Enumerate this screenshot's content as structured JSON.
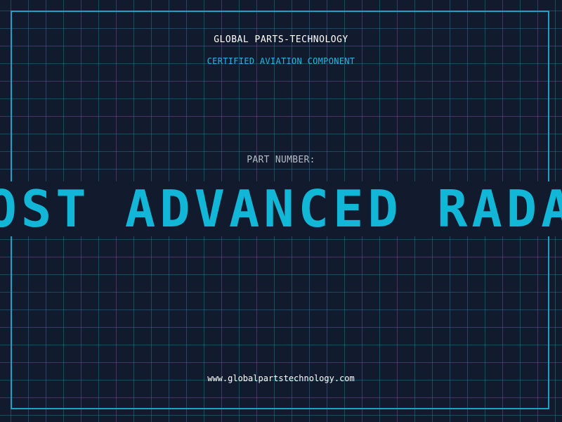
{
  "header": {
    "company": "GLOBAL PARTS-TECHNOLOGY",
    "subtitle": "CERTIFIED AVIATION COMPONENT"
  },
  "part": {
    "label": "PART NUMBER:",
    "value": "MOST ADVANCED RADAR"
  },
  "footer": {
    "url": "www.globalpartstechnology.com"
  },
  "colors": {
    "background": "#121a2e",
    "accent": "#12b7d8",
    "frame": "#1aa3c9",
    "grid": "#286e8c"
  }
}
